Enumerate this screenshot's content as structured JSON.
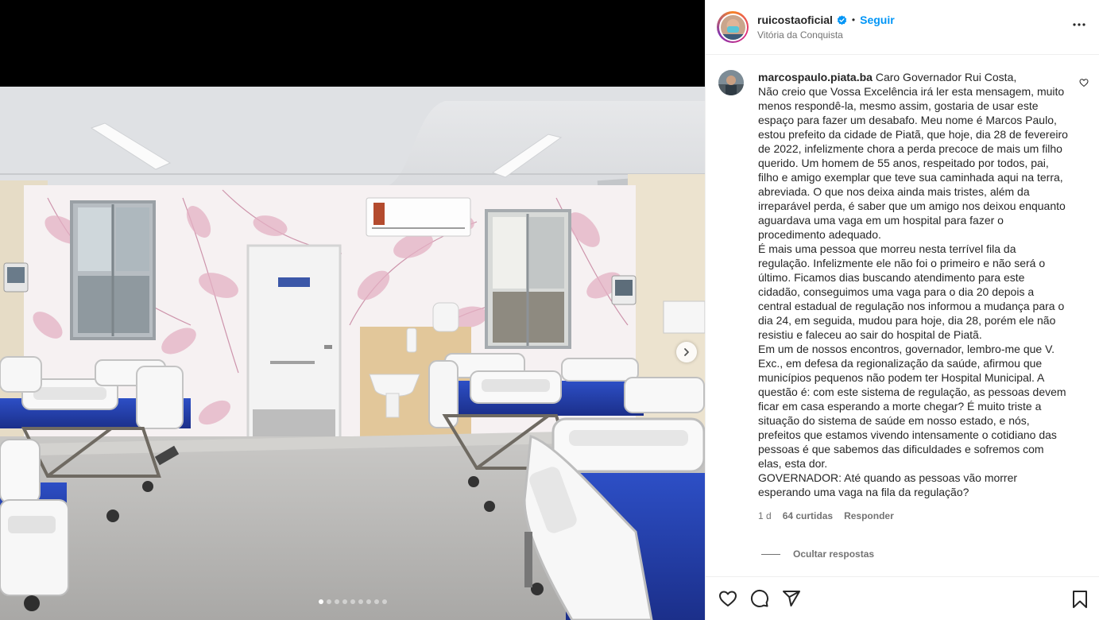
{
  "post": {
    "username": "ruicostaoficial",
    "separator": "•",
    "follow_label": "Seguir",
    "location": "Vitória da Conquista",
    "carousel": {
      "total": 9,
      "active": 0
    }
  },
  "comment": {
    "username": "marcospaulo.piata.ba",
    "text": " Caro Governador Rui Costa,\nNão creio que Vossa Excelência irá ler esta mensagem, muito menos respondê-la, mesmo assim, gostaria de usar este espaço para fazer um desabafo. Meu nome é Marcos Paulo, estou prefeito da cidade de Piatã, que hoje, dia 28 de fevereiro de 2022, infelizmente chora a perda precoce de mais um filho querido. Um homem de 55 anos, respeitado por todos, pai, filho e amigo exemplar que teve sua caminhada aqui na terra, abreviada. O que nos deixa ainda mais tristes, além da irreparável perda, é saber que um amigo nos deixou enquanto aguardava uma vaga em um hospital para fazer o procedimento adequado.\nÉ mais uma pessoa que morreu nesta terrível fila da regulação. Infelizmente ele não foi o primeiro e não será o último. Ficamos dias buscando atendimento para este cidadão, conseguimos uma vaga para o dia 20 depois a central estadual de regulação nos informou a mudança para o dia 24, em seguida, mudou para hoje, dia 28, porém ele não resistiu e faleceu ao sair do hospital de Piatã.\nEm um de nossos encontros, governador, lembro-me que V. Exc., em defesa da regionalização da saúde, afirmou que municípios pequenos não podem ter Hospital Municipal. A questão é: com este sistema de regulação, as pessoas devem ficar em casa esperando a morte chegar? É muito triste a situação do sistema de saúde em nosso estado, e nós, prefeitos que estamos vivendo intensamente o cotidiano das pessoas é que sabemos das dificuldades e sofremos com elas, esta dor.\nGOVERNADOR: Até quando as pessoas vão morrer esperando uma vaga na fila da regulação?",
    "time": "1 d",
    "likes": "64 curtidas",
    "reply_label": "Responder",
    "hide_replies_label": "Ocultar respostas"
  },
  "icons": {
    "more": "more-options-icon",
    "verified": "verified-badge-icon",
    "like": "heart-icon",
    "comment": "comment-icon",
    "share": "share-icon",
    "save": "bookmark-icon",
    "next": "chevron-right-icon"
  },
  "colors": {
    "accent": "#0095f6",
    "secondary_text": "#737373",
    "border": "#efefef"
  }
}
